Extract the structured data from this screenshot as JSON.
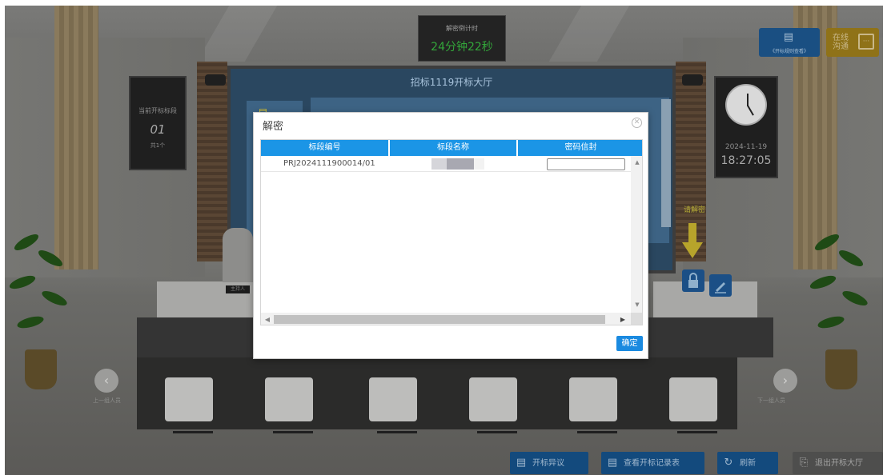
{
  "hall": {
    "timer": {
      "label": "解密倒计时",
      "value": "24分钟22秒"
    },
    "screen_title": "招标1119开标大厅",
    "screen_left_text": "是",
    "current_lot": {
      "label": "当前开标标段",
      "number": "01",
      "count": "共1个"
    },
    "clock": {
      "date": "2024-11-19",
      "time": "18:27:05"
    },
    "host_tag": "主持人",
    "decrypt_hint": "请解密",
    "prev_label": "上一组人员",
    "next_label": "下一组人员",
    "prev_icon": "chevron-left-icon",
    "next_icon": "chevron-right-icon"
  },
  "top_buttons": {
    "rules_label": "《开标规则查看》",
    "rules_icon": "document-icon",
    "chat_label": "在线沟通",
    "chat_icon": "chat-icon"
  },
  "bottom_buttons": [
    {
      "label": "开标异议",
      "icon": "document-icon"
    },
    {
      "label": "查看开标记录表",
      "icon": "document-icon"
    },
    {
      "label": "刷新",
      "icon": "refresh-icon"
    },
    {
      "label": "退出开标大厅",
      "icon": "exit-icon"
    }
  ],
  "dialog": {
    "title": "解密",
    "close_icon": "close-icon",
    "columns": [
      "标段编号",
      "标段名称",
      "密码信封"
    ],
    "rows": [
      {
        "lot_code": "PRJ2024111900014/01",
        "lot_name": "",
        "password": ""
      }
    ],
    "confirm_label": "确定"
  },
  "colors": {
    "header_blue": "#1b95e6",
    "confirm_blue": "#1a8ae0",
    "timer_green": "#33a63a"
  }
}
